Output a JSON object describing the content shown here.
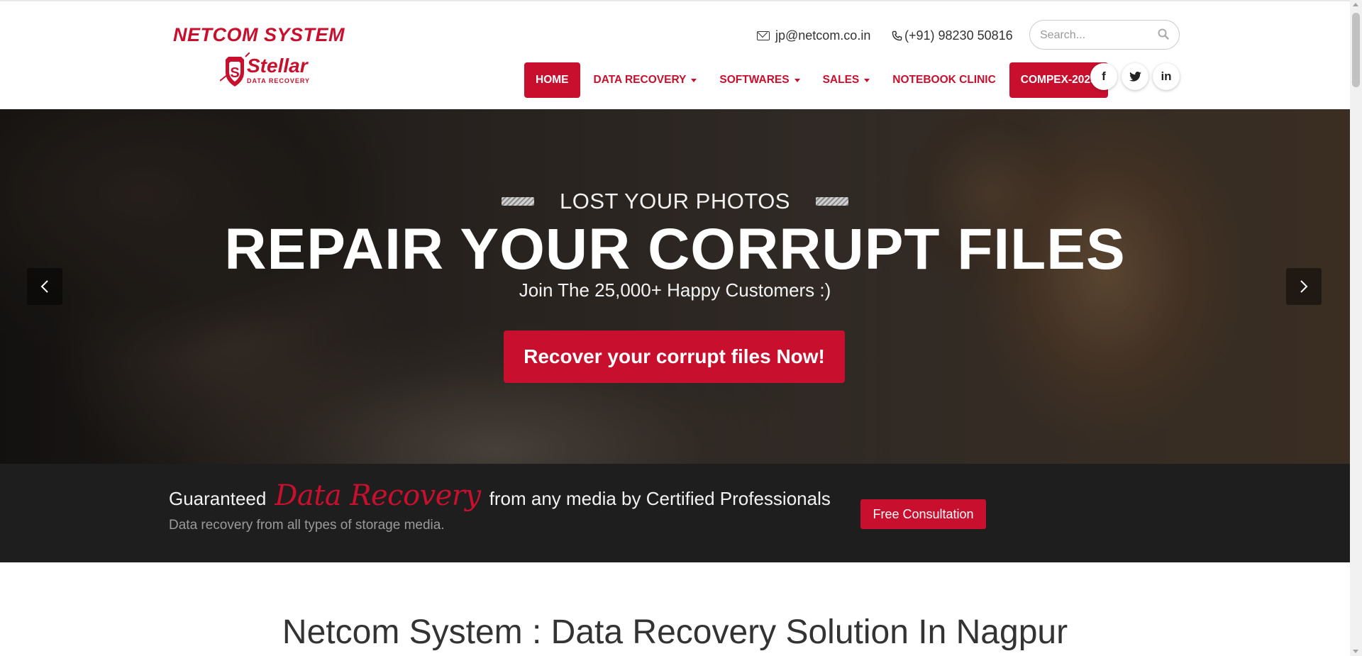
{
  "brand": {
    "name": "NETCOM SYSTEM",
    "partner_logo_text": "Stellar",
    "partner_logo_subtext": "DATA RECOVERY",
    "accent_color": "#c8102e"
  },
  "contact": {
    "email": "jp@netcom.co.in",
    "email_icon": "envelope-icon",
    "phone": "(+91) 98230 50816",
    "phone_icon": "phone-icon"
  },
  "search": {
    "placeholder": "Search...",
    "icon": "search-icon"
  },
  "nav": {
    "home": "HOME",
    "data_recovery": "DATA RECOVERY",
    "softwares": "SOFTWARES",
    "sales": "SALES",
    "notebook_clinic": "NOTEBOOK CLINIC",
    "compex": "COMPEX-2025"
  },
  "social": {
    "facebook": "f",
    "twitter_icon": "twitter-icon",
    "linkedin": "in"
  },
  "hero": {
    "eyebrow": "LOST YOUR PHOTOS",
    "title": "REPAIR YOUR CORRUPT FILES",
    "subtitle": "Join The 25,000+ Happy Customers :)",
    "cta": "Recover your corrupt files Now!",
    "prev_icon": "chevron-left-icon",
    "next_icon": "chevron-right-icon"
  },
  "promo": {
    "prefix": "Guaranteed",
    "highlight": "Data Recovery",
    "suffix": "from any media by Certified Professionals",
    "subtext": "Data recovery from all types of storage media.",
    "button": "Free Consultation"
  },
  "section": {
    "title": "Netcom System : Data Recovery Solution In Nagpur"
  }
}
